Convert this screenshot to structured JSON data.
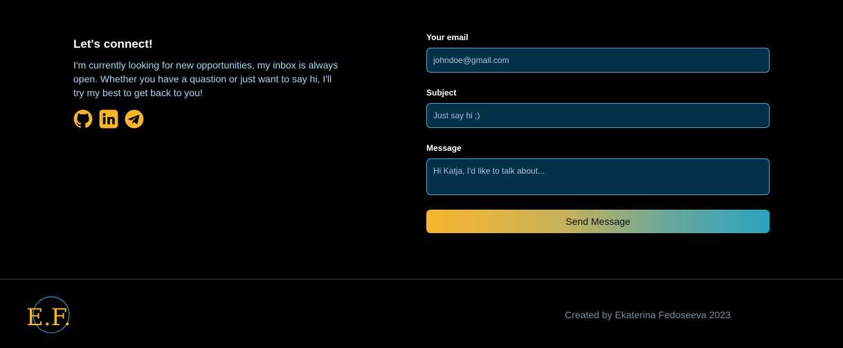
{
  "contact": {
    "heading": "Let's connect!",
    "intro": "I'm currently looking for new opportunities, my inbox is always open. Whether you have a quastion or just want to say hi, I'll try my best to get back to you!",
    "socials": [
      {
        "icon": "github-icon"
      },
      {
        "icon": "linkedin-icon"
      },
      {
        "icon": "telegram-icon"
      }
    ]
  },
  "form": {
    "email_label": "Your email",
    "email_placeholder": "johndoe@gmail.com",
    "subject_label": "Subject",
    "subject_placeholder": "Just say hi ;)",
    "message_label": "Message",
    "message_placeholder": "Hi Katja, I'd like to talk about...",
    "submit_label": "Send Message"
  },
  "footer": {
    "logo_text": "E.F.",
    "credit": "Created by Ekaterina Fedoseeva 2023"
  },
  "colors": {
    "accent": "#f7b52b",
    "accent_end": "#2aa2c0",
    "input_bg": "#04314a",
    "input_border": "#4ba6c9",
    "text_light": "#a8d8ee"
  }
}
